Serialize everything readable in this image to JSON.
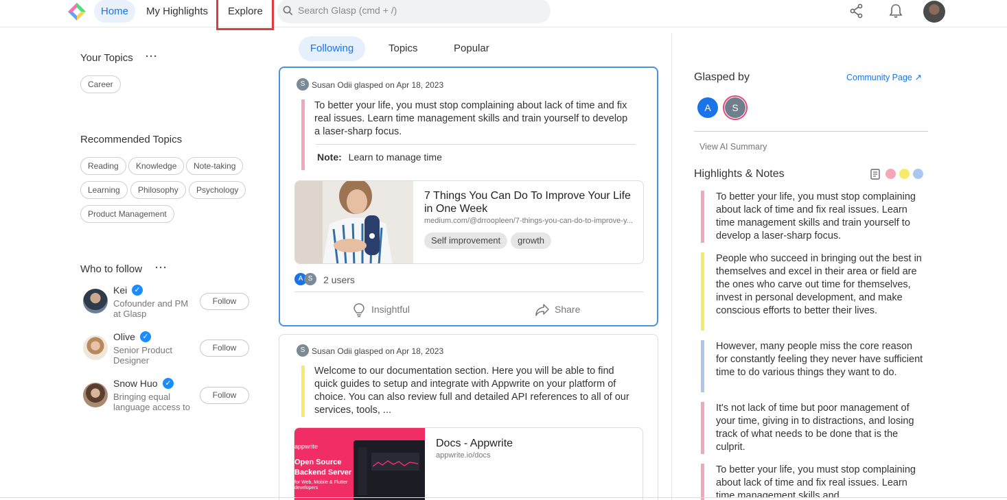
{
  "nav": {
    "home": "Home",
    "my_highlights": "My Highlights",
    "explore": "Explore",
    "search_placeholder": "Search Glasp (cmd + /)"
  },
  "left": {
    "your_topics_title": "Your Topics",
    "your_topics": [
      "Career"
    ],
    "recommended_title": "Recommended Topics",
    "recommended": [
      "Reading",
      "Knowledge",
      "Note-taking",
      "Learning",
      "Philosophy",
      "Psychology",
      "Product Management"
    ],
    "who_to_follow_title": "Who to follow",
    "follow_label": "Follow",
    "people": [
      {
        "name": "Kei",
        "desc": "Cofounder and PM at Glasp"
      },
      {
        "name": "Olive",
        "desc": "Senior Product Designer"
      },
      {
        "name": "Snow Huo",
        "desc": "Bringing equal language access to"
      }
    ],
    "more_icon": "···"
  },
  "tabs": [
    "Following",
    "Topics",
    "Popular"
  ],
  "cards": [
    {
      "avatar_letter": "S",
      "user": "Susan Odii",
      "action": "glasped on Apr 18, 2023",
      "quote": "To better your life, you must stop complaining about lack of time and fix real issues. Learn time management skills and train yourself to develop a laser-sharp focus.",
      "note_label": "Note:",
      "note_text": "Learn to manage time",
      "link_title": "7 Things You Can Do To Improve Your Life in One Week",
      "link_url": "medium.com/@drroopleen/7-things-you-can-do-to-improve-y...",
      "tags": [
        "Self improvement",
        "growth"
      ],
      "users_count": "2 users",
      "insightful": "Insightful",
      "share": "Share",
      "bar_color": "#f4a7b9"
    },
    {
      "avatar_letter": "S",
      "user": "Susan Odii",
      "action": "glasped on Apr 18, 2023",
      "quote": "Welcome to our documentation section. Here you will be able to find quick guides to setup and integrate with Appwrite on your platform of choice. You can also review full and detailed API references to all of our services, tools, ...",
      "link_title": "Docs - Appwrite",
      "link_url": "appwrite.io/docs",
      "thumb_brand": "appwrite",
      "thumb_title_1": "Open Source",
      "thumb_title_2": "Backend Server",
      "thumb_sub": "for Web, Mobile & Flutter developers",
      "bar_color": "#f7e96b"
    }
  ],
  "right": {
    "glasped_by": "Glasped by",
    "community_link": "Community Page ↗",
    "avatars": [
      "A",
      "S"
    ],
    "view_ai_summary": "View AI Summary",
    "highlights_title": "Highlights & Notes",
    "highlights": [
      {
        "text": "To better your life, you must stop complaining about lack of time and fix real issues. Learn time management skills and train yourself to develop a laser-sharp focus.",
        "color": "#f4a7b9"
      },
      {
        "text": "People who succeed in bringing out the best in themselves and excel in their area or field are the ones who carve out time for themselves, invest in personal development, and make conscious efforts to better their lives.",
        "color": "#f7e96b"
      },
      {
        "text": "However, many people miss the core reason for constantly feeling they never have sufficient time to do various things they want to do.",
        "color": "#a9c8f0"
      },
      {
        "text": "It's not lack of time but poor management of your time, giving in to distractions, and losing track of what needs to be done that is the culprit.",
        "color": "#f4a7b9"
      },
      {
        "text": "To better your life, you must stop complaining about lack of time and fix real issues. Learn time management skills and",
        "color": "#f4a7b9"
      }
    ],
    "color_filters": [
      "#f4a7b9",
      "#f7e96b",
      "#a9c8f0"
    ]
  }
}
